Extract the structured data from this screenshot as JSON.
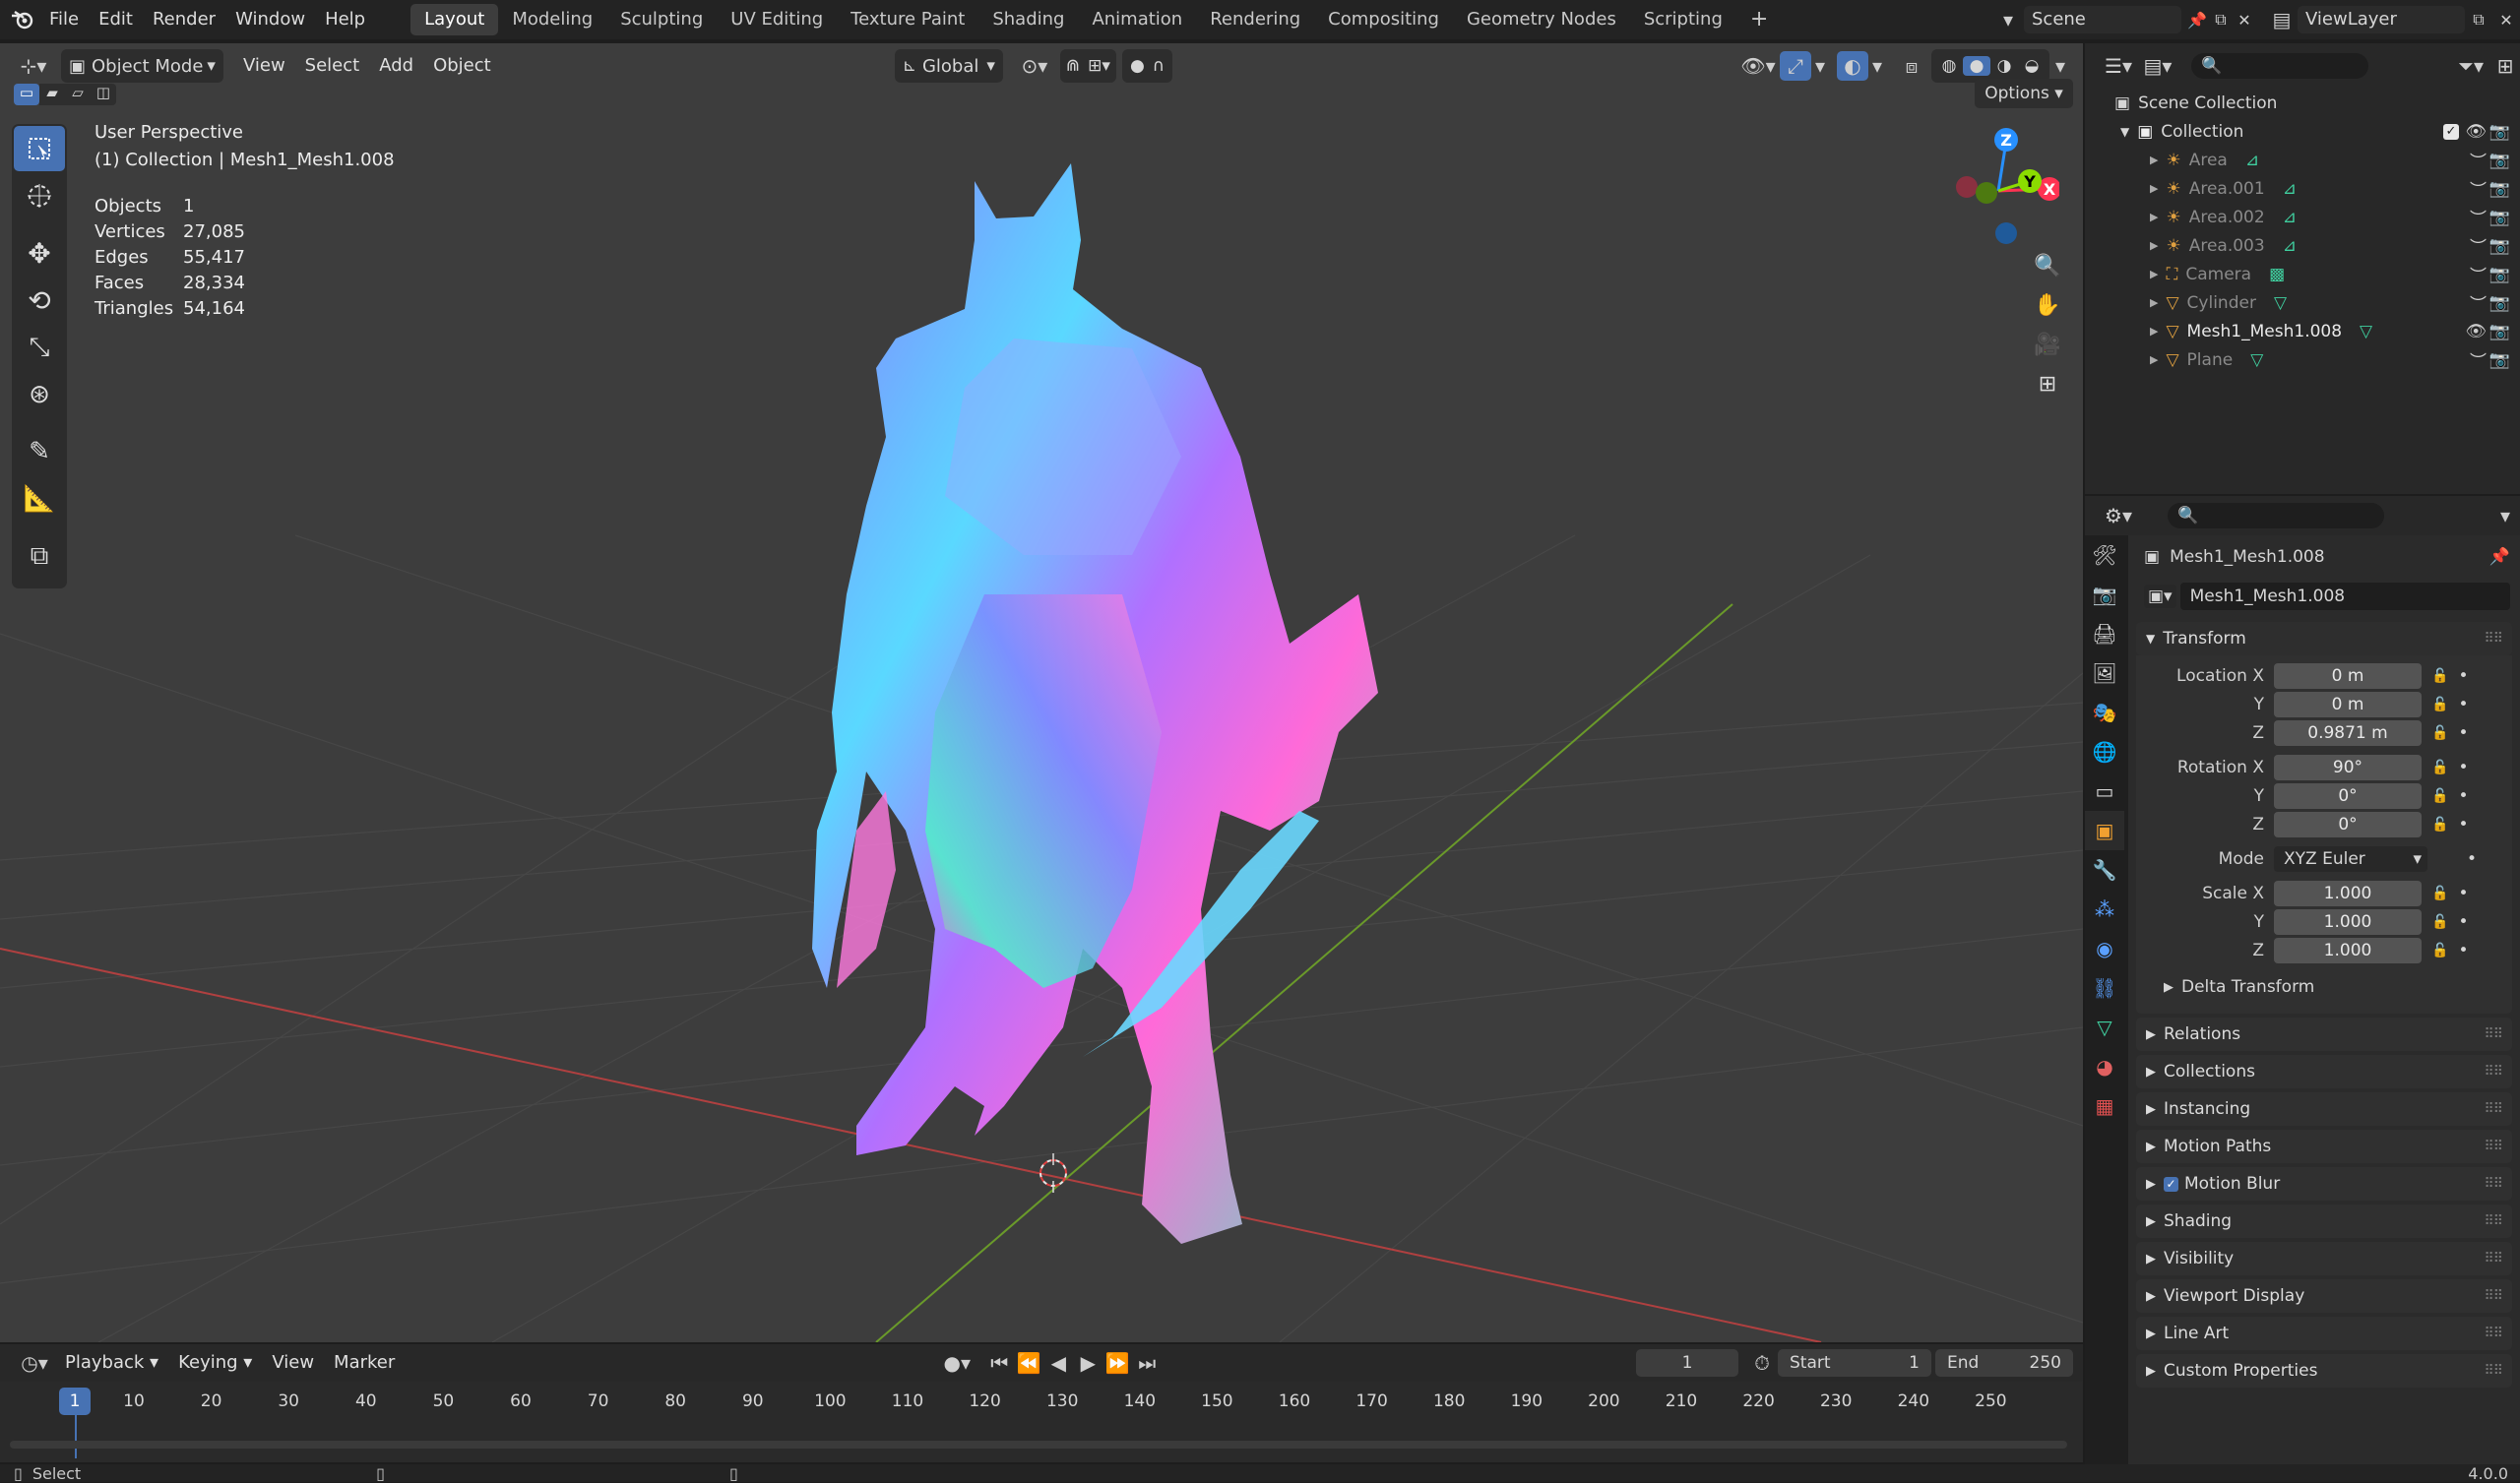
{
  "menu": {
    "items": [
      "File",
      "Edit",
      "Render",
      "Window",
      "Help"
    ]
  },
  "workspaces": {
    "tabs": [
      "Layout",
      "Modeling",
      "Sculpting",
      "UV Editing",
      "Texture Paint",
      "Shading",
      "Animation",
      "Rendering",
      "Compositing",
      "Geometry Nodes",
      "Scripting"
    ],
    "active": "Layout",
    "add": "+"
  },
  "scene": {
    "name": "Scene",
    "view_layer": "ViewLayer"
  },
  "viewport": {
    "mode": "Object Mode",
    "menus": [
      "View",
      "Select",
      "Add",
      "Object"
    ],
    "orientation": "Global",
    "options": "Options",
    "view_name": "User Perspective",
    "collection_info": "(1) Collection | Mesh1_Mesh1.008",
    "stats": [
      {
        "label": "Objects",
        "value": "1"
      },
      {
        "label": "Vertices",
        "value": "27,085"
      },
      {
        "label": "Edges",
        "value": "55,417"
      },
      {
        "label": "Faces",
        "value": "28,334"
      },
      {
        "label": "Triangles",
        "value": "54,164"
      }
    ],
    "gizmo": {
      "z": "Z",
      "y": "Y",
      "x": "X"
    }
  },
  "outliner": {
    "root": "Scene Collection",
    "collection": "Collection",
    "items": [
      {
        "name": "Area",
        "type": "light",
        "visible": false
      },
      {
        "name": "Area.001",
        "type": "light",
        "visible": false
      },
      {
        "name": "Area.002",
        "type": "light",
        "visible": false
      },
      {
        "name": "Area.003",
        "type": "light",
        "visible": false
      },
      {
        "name": "Camera",
        "type": "camera",
        "visible": false
      },
      {
        "name": "Cylinder",
        "type": "mesh",
        "visible": false
      },
      {
        "name": "Mesh1_Mesh1.008",
        "type": "mesh",
        "visible": true
      },
      {
        "name": "Plane",
        "type": "mesh",
        "visible": false
      }
    ]
  },
  "properties": {
    "object_name": "Mesh1_Mesh1.008",
    "object_field": "Mesh1_Mesh1.008",
    "transform_title": "Transform",
    "location": {
      "label": "Location X",
      "x": "0 m",
      "y": "0 m",
      "z": "0.9871 m"
    },
    "rotation": {
      "label": "Rotation X",
      "x": "90°",
      "y": "0°",
      "z": "0°"
    },
    "mode": {
      "label": "Mode",
      "value": "XYZ Euler"
    },
    "scale": {
      "label": "Scale X",
      "x": "1.000",
      "y": "1.000",
      "z": "1.000"
    },
    "axis_y": "Y",
    "axis_z": "Z",
    "delta": "Delta Transform",
    "panels": [
      "Relations",
      "Collections",
      "Instancing",
      "Motion Paths",
      "Motion Blur",
      "Shading",
      "Visibility",
      "Viewport Display",
      "Line Art",
      "Custom Properties"
    ]
  },
  "timeline": {
    "menus": [
      "Playback",
      "Keying",
      "View",
      "Marker"
    ],
    "current_frame": "1",
    "start_label": "Start",
    "start": "1",
    "end_label": "End",
    "end": "250",
    "ticks": [
      "10",
      "20",
      "30",
      "40",
      "50",
      "60",
      "70",
      "80",
      "90",
      "100",
      "110",
      "120",
      "130",
      "140",
      "150",
      "160",
      "170",
      "180",
      "190",
      "200",
      "210",
      "220",
      "230",
      "240",
      "250"
    ],
    "cursor": "1"
  },
  "status": {
    "left": "Select",
    "version": "4.0.0"
  },
  "colors": {
    "accent": "#4772b3",
    "axis_x": "#ff3352",
    "axis_y": "#8bdc00",
    "axis_z": "#2890ff"
  }
}
